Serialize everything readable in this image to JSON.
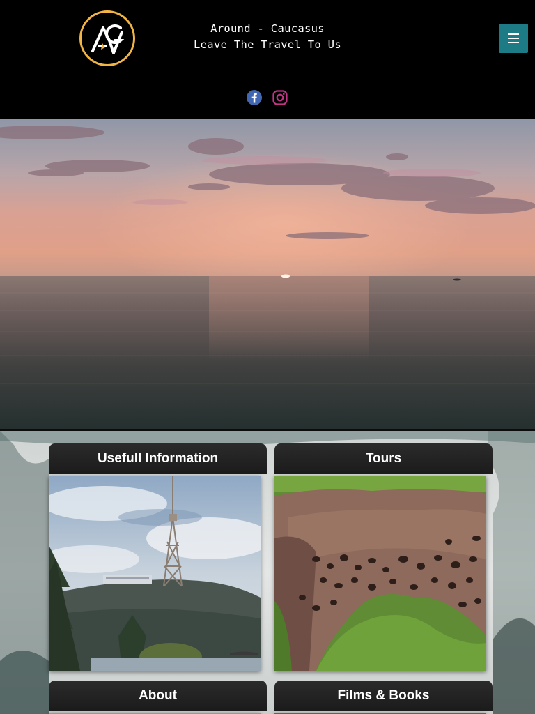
{
  "site": {
    "title": "Around - Caucasus",
    "tagline": "Leave The Travel To Us"
  },
  "header": {
    "logo_icon": "ac-logo-icon",
    "menu_icon": "hamburger-menu-icon",
    "social": [
      {
        "name": "facebook-icon",
        "color": "#4267b2"
      },
      {
        "name": "instagram-icon",
        "color": "#c13584"
      }
    ]
  },
  "colors": {
    "accent": "#1d7b86",
    "logo_ring": "#f2b544",
    "header_bg": "#000000"
  },
  "cards": [
    {
      "title": "Usefull Information"
    },
    {
      "title": "Tours"
    },
    {
      "title": "About"
    },
    {
      "title": "Films & Books"
    }
  ]
}
